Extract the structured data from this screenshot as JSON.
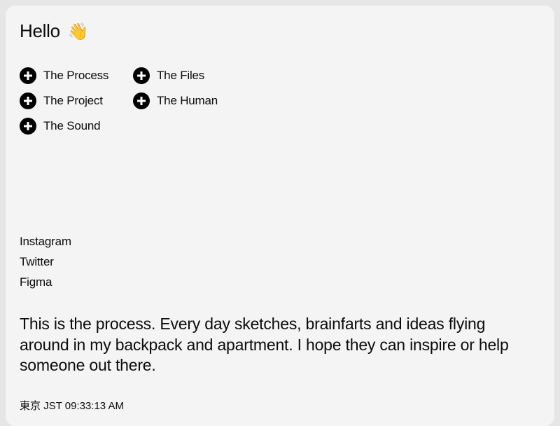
{
  "header": {
    "greeting": "Hello",
    "greeting_emoji": "👋"
  },
  "nav": {
    "items": [
      {
        "label": "The Process",
        "icon": "plus-circle-icon"
      },
      {
        "label": "The Files",
        "icon": "plus-circle-icon"
      },
      {
        "label": "The Project",
        "icon": "plus-circle-icon"
      },
      {
        "label": "The Human",
        "icon": "plus-circle-icon"
      },
      {
        "label": "The Sound",
        "icon": "plus-circle-icon"
      }
    ]
  },
  "social": {
    "links": [
      "Instagram",
      "Twitter",
      "Figma"
    ]
  },
  "intro": {
    "text": "This is the process. Every day sketches, brainfarts and ideas flying around in my backpack and apartment. I hope they can inspire or help someone out there."
  },
  "clock": {
    "city": "東京",
    "timezone": "JST",
    "time": "09:33:13 AM"
  },
  "colors": {
    "background": "#e6e6e6",
    "card": "#f4f4f4",
    "text": "#0b0b0b",
    "icon": "#000000"
  }
}
